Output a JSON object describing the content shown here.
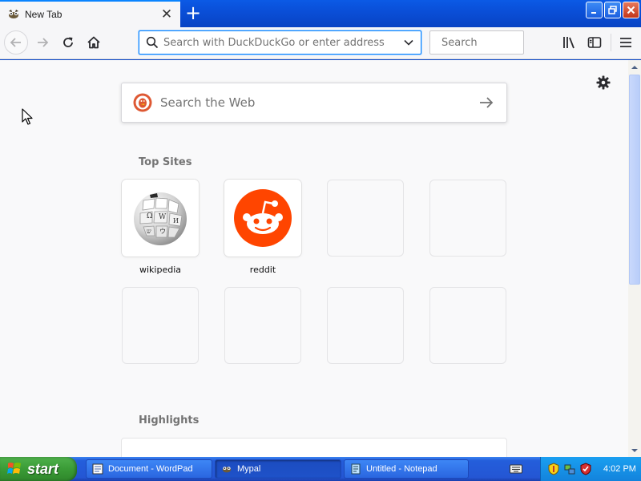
{
  "browser": {
    "tab": {
      "title": "New Tab",
      "favicon": "mypal-favicon"
    },
    "newtab_icon": "plus-icon",
    "urlbar": {
      "placeholder": "Search with DuckDuckGo or enter address",
      "value": ""
    },
    "searchbar": {
      "placeholder": "Search",
      "value": ""
    },
    "toolbar_icons": [
      "back-icon",
      "forward-icon",
      "reload-icon",
      "home-icon",
      "library-icon",
      "sidebar-icon",
      "menu-icon"
    ]
  },
  "newtab": {
    "websearch": {
      "placeholder": "Search the Web",
      "engine_icon": "duckduckgo-icon"
    },
    "top_sites_title": "Top Sites",
    "top_sites": [
      {
        "label": "wikipedia",
        "icon": "wikipedia-globe-icon"
      },
      {
        "label": "reddit",
        "icon": "reddit-icon",
        "color": "#ff4500"
      }
    ],
    "highlights_title": "Highlights"
  },
  "taskbar": {
    "start_label": "start",
    "tasks": [
      {
        "label": "Document - WordPad"
      },
      {
        "label": "Mypal"
      },
      {
        "label": "Untitled - Notepad"
      }
    ],
    "clock": "4:02 PM"
  },
  "colors": {
    "accent": "#0a84ff",
    "reddit": "#ff4500",
    "ddg": "#de5833",
    "xp_blue": "#245edb",
    "xp_green": "#3a9b36"
  }
}
